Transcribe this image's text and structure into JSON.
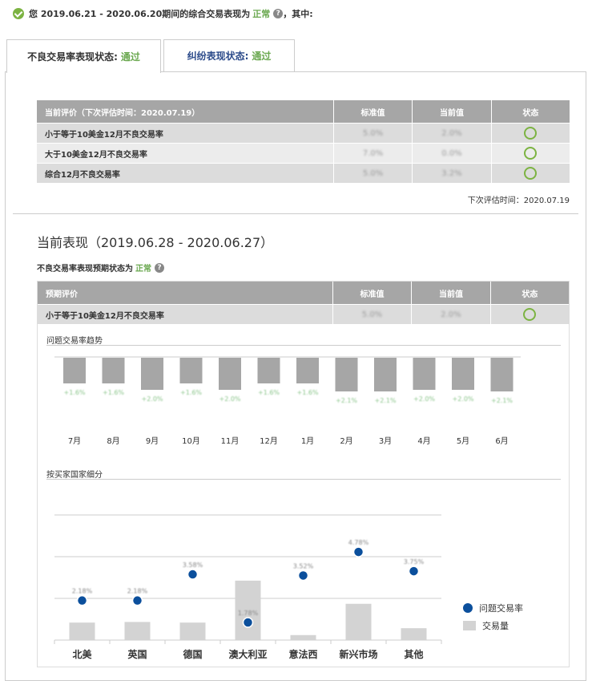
{
  "summary": {
    "prefix": "您 2019.06.21 - 2020.06.20期间的综合交易表现为",
    "status": "正常",
    "suffix": "，其中:"
  },
  "tabs": [
    {
      "label": "不良交易率表现状态:",
      "status": "通过"
    },
    {
      "label": "纠纷表现状态:",
      "status": "通过"
    }
  ],
  "eval_table": {
    "headers": [
      "当前评价（下次评估时间：2020.07.19）",
      "标准值",
      "当前值",
      "状态"
    ],
    "rows": [
      {
        "name": "小于等于10美金12月不良交易率",
        "standard": "5.0%",
        "current": "2.0%"
      },
      {
        "name": "大于10美金12月不良交易率",
        "standard": "7.0%",
        "current": "0.0%"
      },
      {
        "name": "综合12月不良交易率",
        "standard": "5.0%",
        "current": "3.2%"
      }
    ],
    "next_eval": "下次评估时间：2020.07.19"
  },
  "current": {
    "title": "当前表现（2019.06.28 - 2020.06.27）",
    "status_prefix": "不良交易率表现预期状态为",
    "status": "正常"
  },
  "forecast_table": {
    "headers": [
      "预期评价",
      "标准值",
      "当前值",
      "状态"
    ],
    "rows": [
      {
        "name": "小于等于10美金12月不良交易率",
        "standard": "5.0%",
        "current": "2.0%"
      }
    ]
  },
  "trend": {
    "title": "问题交易率趋势",
    "months": [
      "7月",
      "8月",
      "9月",
      "10月",
      "11月",
      "12月",
      "1月",
      "2月",
      "3月",
      "4月",
      "5月",
      "6月"
    ],
    "labels": [
      "+1.6%",
      "+1.6%",
      "+2.0%",
      "+1.6%",
      "+2.0%",
      "+1.6%",
      "+1.6%",
      "+2.1%",
      "+2.1%",
      "+2.0%",
      "+2.0%",
      "+2.1%"
    ],
    "values": [
      1.6,
      1.6,
      2.0,
      1.6,
      2.0,
      1.6,
      1.6,
      2.1,
      2.1,
      2.0,
      2.0,
      2.1
    ]
  },
  "country": {
    "title": "按买家国家细分",
    "categories": [
      "北美",
      "英国",
      "德国",
      "澳大利亚",
      "意法西",
      "新兴市场",
      "其他"
    ],
    "rate_labels": [
      "2.18%",
      "2.18%",
      "3.58%",
      "1.78%",
      "3.52%",
      "4.78%",
      "3.75%"
    ],
    "rates": [
      2.18,
      2.18,
      3.58,
      1.78,
      3.52,
      4.78,
      3.75
    ],
    "volumes": [
      28,
      29,
      28,
      95,
      8,
      58,
      19
    ],
    "legend_rate": "问题交易率",
    "legend_volume": "交易量"
  },
  "colors": {
    "accent_green": "#6aa84f",
    "dot_blue": "#0b4f9c",
    "bar_gray": "#a6a6a6",
    "volume_gray": "#d3d3d3"
  }
}
